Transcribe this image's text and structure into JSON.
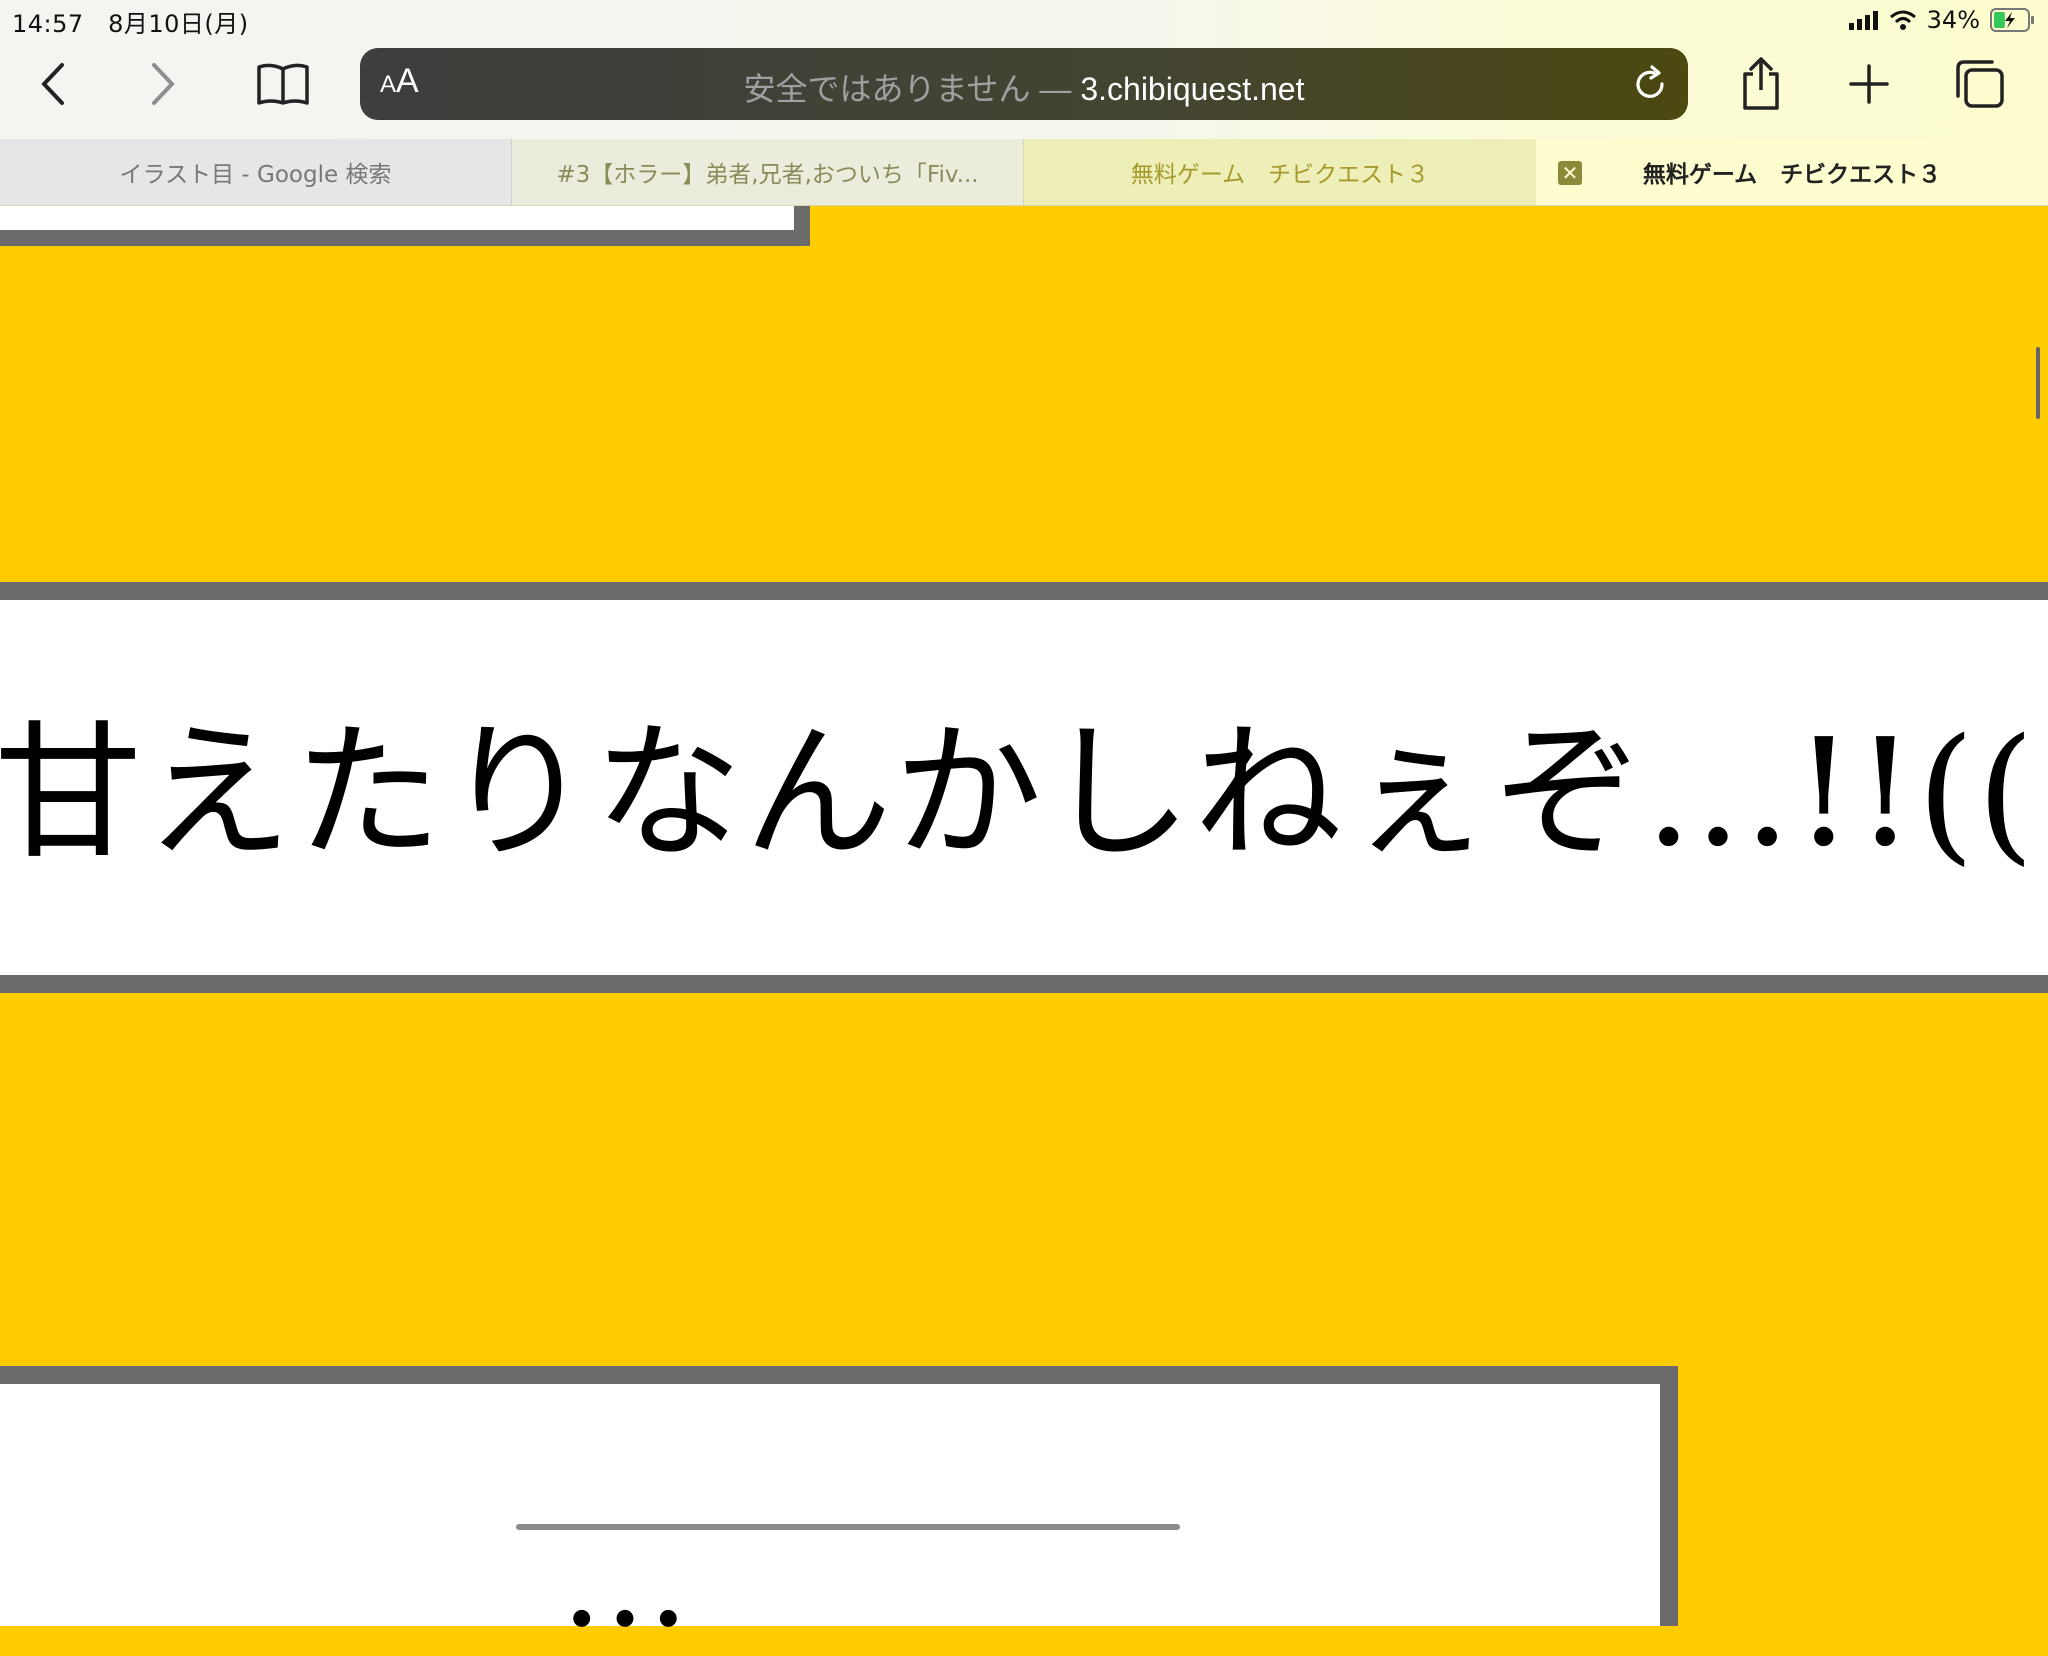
{
  "status_bar": {
    "time": "14:57",
    "date": "8月10日(月)",
    "battery_percent": "34%",
    "battery_level": 0.34,
    "icons": [
      "signal-icon",
      "wifi-icon",
      "battery-charging-icon"
    ]
  },
  "toolbar": {
    "buttons": [
      "back-icon",
      "forward-icon",
      "bookmarks-icon",
      "share-icon",
      "new-tab-icon",
      "tabs-overview-icon"
    ],
    "address_bar": {
      "aa_small": "A",
      "aa_big": "A",
      "warning": "安全ではありません — ",
      "domain": "3.chibiquest.net"
    }
  },
  "tabs": [
    {
      "title": "イラスト目 - Google 検索"
    },
    {
      "title": "#3【ホラー】弟者,兄者,おついち「Fiv..."
    },
    {
      "title": "無料ゲーム　チビクエスト３"
    },
    {
      "title": "無料ゲーム　チビクエスト３",
      "close_label": "✕"
    }
  ],
  "content": {
    "banner_text": "甘えたりなんかしねぇぞ…!!(((",
    "bottom_partial_text": "…"
  },
  "colors": {
    "page_background": "#FFCC00",
    "box_border": "#6a6a6a",
    "box_fill": "#FFFFFF"
  }
}
